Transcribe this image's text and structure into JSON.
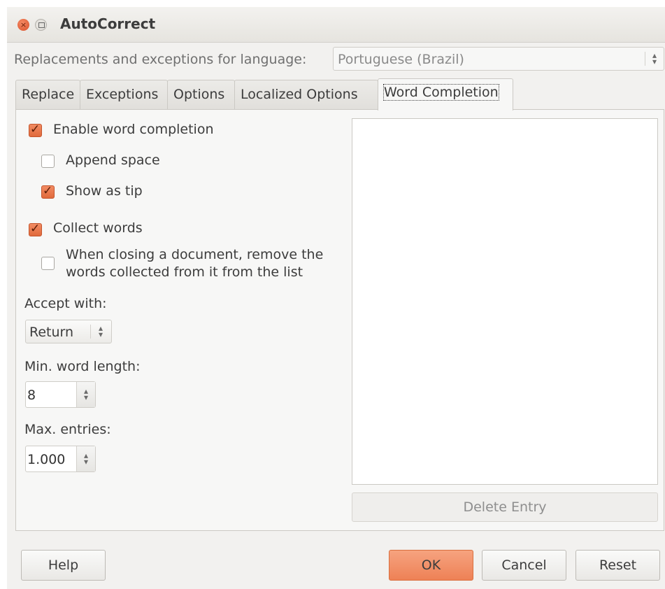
{
  "window": {
    "title": "AutoCorrect",
    "close_glyph": "×"
  },
  "language": {
    "label": "Replacements and exceptions for language:",
    "selected": "Portuguese (Brazil)"
  },
  "tabs": [
    {
      "label": "Replace"
    },
    {
      "label": "Exceptions"
    },
    {
      "label": "Options"
    },
    {
      "label": "Localized Options"
    },
    {
      "label": "Word Completion",
      "active": true
    }
  ],
  "word_completion": {
    "enable_label": "Enable word completion",
    "enable_checked": true,
    "append_space_label": "Append space",
    "append_space_checked": false,
    "show_as_tip_label": "Show as tip",
    "show_as_tip_checked": true,
    "collect_words_label": "Collect words",
    "collect_words_checked": true,
    "remove_on_close_label_1": "When closing a document, remove the",
    "remove_on_close_label_2": "words collected from it from the list",
    "remove_on_close_checked": false,
    "accept_with_label": "Accept with:",
    "accept_with_value": "Return",
    "min_length_label": "Min. word length:",
    "min_length_value": "8",
    "max_entries_label": "Max. entries:",
    "max_entries_value": "1.000",
    "delete_entry_label": "Delete Entry"
  },
  "buttons": {
    "help": "Help",
    "ok": "OK",
    "cancel": "Cancel",
    "reset": "Reset"
  },
  "colors": {
    "accent": "#ee8156",
    "check_fill": "#e06a3c"
  },
  "icons": {
    "spin_up": "▴",
    "spin_down": "▾"
  }
}
